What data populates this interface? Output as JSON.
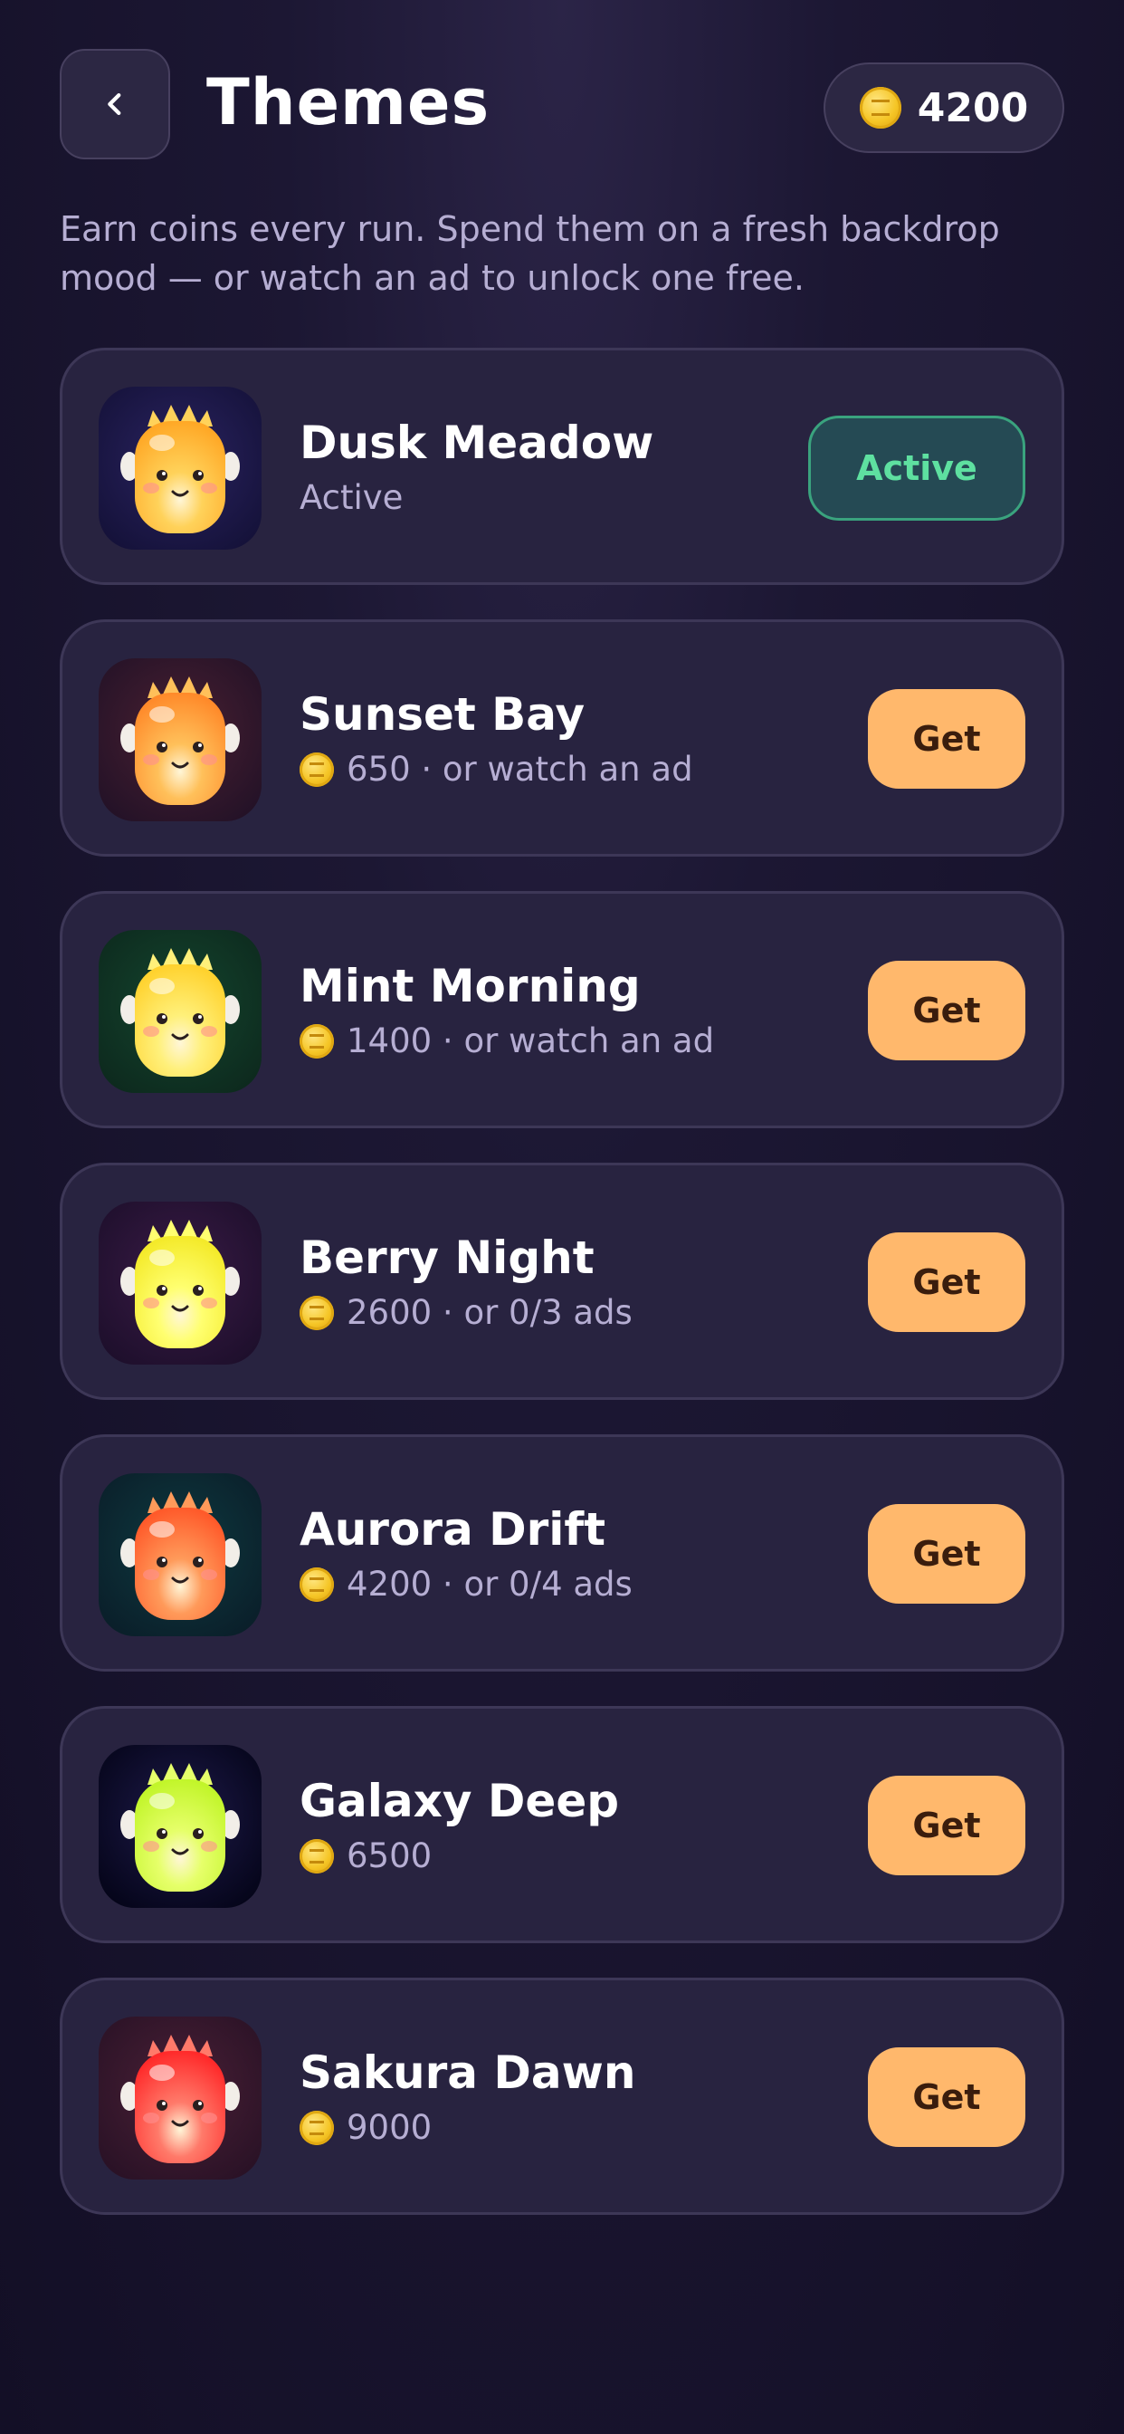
{
  "header": {
    "title": "Themes",
    "coins": "4200",
    "back_icon": "chevron-left-icon",
    "coin_icon": "coin-icon"
  },
  "subtitle": "Earn coins every run. Spend them on a fresh backdrop mood — or watch an ad to unlock one free.",
  "colors": {
    "accent": "#ffb86c",
    "active": "#5ee0a0",
    "muted_text": "#b6aed3",
    "card_bg": "#282340"
  },
  "themes": [
    {
      "name": "Dusk Meadow",
      "status": "Active",
      "price": "",
      "offer": "",
      "button": "Active",
      "bg": "#2a2360",
      "bg2": "#15123a",
      "body1": "#ffd25a",
      "body2": "#ffa826"
    },
    {
      "name": "Sunset Bay",
      "status": "",
      "price": "650",
      "offer": "· or watch an ad",
      "button": "Get",
      "bg": "#4a2032",
      "bg2": "#241227",
      "body1": "#ffc05a",
      "body2": "#ff8a2a"
    },
    {
      "name": "Mint Morning",
      "status": "",
      "price": "1400",
      "offer": "· or watch an ad",
      "button": "Get",
      "bg": "#14452e",
      "bg2": "#0d2a1e",
      "body1": "#fff07a",
      "body2": "#ffd22e"
    },
    {
      "name": "Berry Night",
      "status": "",
      "price": "2600",
      "offer": "· or 0/3 ads",
      "button": "Get",
      "bg": "#3a1b46",
      "bg2": "#1e0f2c",
      "body1": "#ffff70",
      "body2": "#f4ea2a"
    },
    {
      "name": "Aurora Drift",
      "status": "",
      "price": "4200",
      "offer": "· or 0/4 ads",
      "button": "Get",
      "bg": "#0f3a40",
      "bg2": "#0a1f2a",
      "body1": "#ff9a5a",
      "body2": "#ff5a2a"
    },
    {
      "name": "Galaxy Deep",
      "status": "",
      "price": "6500",
      "offer": "",
      "button": "Get",
      "bg": "#1e1a4a",
      "bg2": "#05051a",
      "body1": "#e6ff6a",
      "body2": "#c2f52a"
    },
    {
      "name": "Sakura Dawn",
      "status": "",
      "price": "9000",
      "offer": "",
      "button": "Get",
      "bg": "#4a2036",
      "bg2": "#2a1226",
      "body1": "#ff7a6a",
      "body2": "#ff2a2a"
    }
  ]
}
